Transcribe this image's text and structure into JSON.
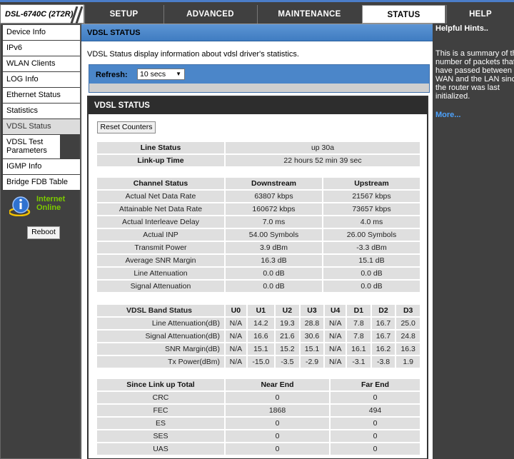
{
  "brand": {
    "model": "DSL-6740C",
    "revision": "(2T2R)"
  },
  "tabs": [
    {
      "label": "SETUP"
    },
    {
      "label": "ADVANCED"
    },
    {
      "label": "MAINTENANCE"
    },
    {
      "label": "STATUS",
      "active": true
    },
    {
      "label": "HELP"
    }
  ],
  "sidebar": {
    "items": [
      {
        "label": "Device Info"
      },
      {
        "label": "IPv6"
      },
      {
        "label": "WLAN Clients"
      },
      {
        "label": "LOG Info"
      },
      {
        "label": "Ethernet Status"
      },
      {
        "label": "Statistics"
      },
      {
        "label": "VDSL Status",
        "active": true
      },
      {
        "label": "VDSL Test Parameters"
      },
      {
        "label": "IGMP Info"
      },
      {
        "label": "Bridge FDB Table"
      }
    ],
    "internet_status": "Internet\nOnline",
    "internet_icon": "globe-info-icon",
    "reboot_label": "Reboot"
  },
  "main": {
    "title": "VDSL STATUS",
    "description": "VDSL Status display information about vdsl driver's statistics.",
    "refresh_label": "Refresh:",
    "refresh_value": "10 secs",
    "box_title": "VDSL STATUS",
    "reset_label": "Reset Counters",
    "line": {
      "rows": [
        {
          "label": "Line Status",
          "value": "up 30a"
        },
        {
          "label": "Link-up Time",
          "value": "22 hours 52 min 39 sec"
        }
      ]
    },
    "channel": {
      "headers": [
        "Channel Status",
        "Downstream",
        "Upstream"
      ],
      "rows": [
        [
          "Actual Net Data Rate",
          "63807 kbps",
          "21567 kbps"
        ],
        [
          "Attainable Net Data Rate",
          "160672 kbps",
          "73657 kbps"
        ],
        [
          "Actual Interleave Delay",
          "7.0 ms",
          "4.0 ms"
        ],
        [
          "Actual INP",
          "54.00 Symbols",
          "26.00 Symbols"
        ],
        [
          "Transmit Power",
          "3.9 dBm",
          "-3.3 dBm"
        ],
        [
          "Average SNR Margin",
          "16.3 dB",
          "15.1 dB"
        ],
        [
          "Line Attenuation",
          "0.0 dB",
          "0.0 dB"
        ],
        [
          "Signal Attenuation",
          "0.0 dB",
          "0.0 dB"
        ]
      ]
    },
    "band": {
      "headers": [
        "VDSL Band Status",
        "U0",
        "U1",
        "U2",
        "U3",
        "U4",
        "D1",
        "D2",
        "D3"
      ],
      "rows": [
        [
          "Line Attenuation(dB)",
          "N/A",
          "14.2",
          "19.3",
          "28.8",
          "N/A",
          "7.8",
          "16.7",
          "25.0"
        ],
        [
          "Signal Attenuation(dB)",
          "N/A",
          "16.6",
          "21.6",
          "30.6",
          "N/A",
          "7.8",
          "16.7",
          "24.8"
        ],
        [
          "SNR Margin(dB)",
          "N/A",
          "15.1",
          "15.2",
          "15.1",
          "N/A",
          "16.1",
          "16.2",
          "16.3"
        ],
        [
          "Tx Power(dBm)",
          "N/A",
          "-15.0",
          "-3.5",
          "-2.9",
          "N/A",
          "-3.1",
          "-3.8",
          "1.9"
        ]
      ]
    },
    "since": {
      "headers": [
        "Since Link up Total",
        "Near End",
        "Far End"
      ],
      "rows": [
        [
          "CRC",
          "0",
          "0"
        ],
        [
          "FEC",
          "1868",
          "494"
        ],
        [
          "ES",
          "0",
          "0"
        ],
        [
          "SES",
          "0",
          "0"
        ],
        [
          "UAS",
          "0",
          "0"
        ]
      ]
    }
  },
  "hints": {
    "title": "Helpful Hints..",
    "body": "This is a summary of the\nnumber of packets that\nhave passed between the\nWAN and the LAN since\nthe router was last\ninitialized.",
    "more": "More..."
  },
  "colors": {
    "accent_blue": "#4b86c9",
    "nav_bg": "#404040",
    "online_green": "#7cc900",
    "link_blue": "#4da3ff"
  }
}
